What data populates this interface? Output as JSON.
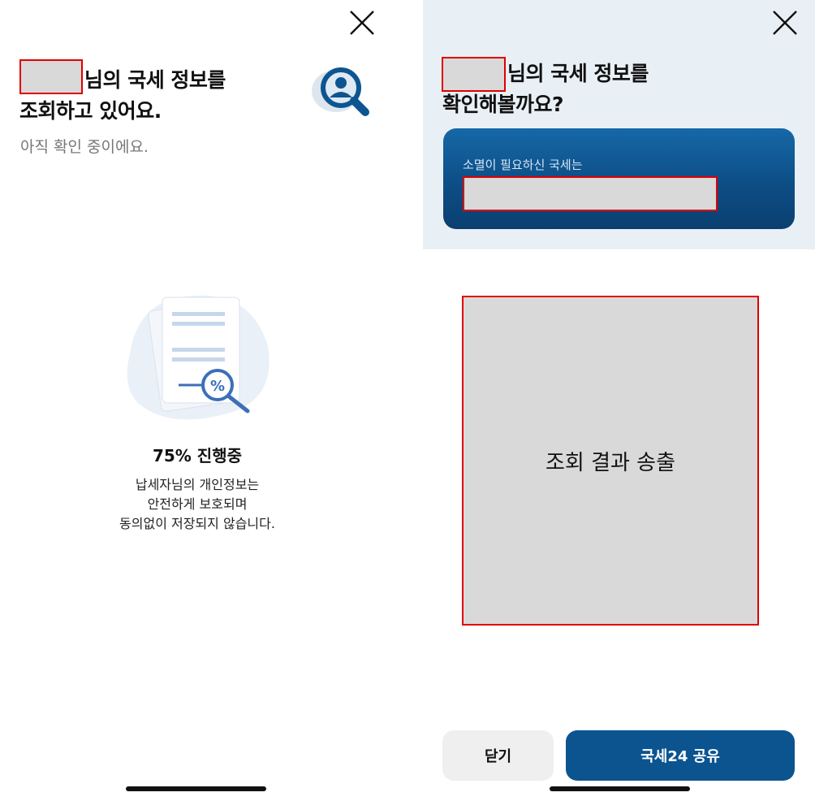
{
  "left": {
    "title_line1": "님의 국세 정보를",
    "title_line2": "조회하고 있어요.",
    "subtitle": "아직 확인 중이에요.",
    "progress": "75% 진행중",
    "progress_percent": 75,
    "info_line1": "납세자님의 개인정보는",
    "info_line2": "안전하게 보호되며",
    "info_line3": "동의없이 저장되지 않습니다.",
    "icons": {
      "close": "close-icon",
      "search": "user-search-icon",
      "document": "document-percent-illustration"
    }
  },
  "right": {
    "title_line1": "님의 국세 정보를",
    "title_line2": "확인해볼까요?",
    "card_label": "소멸이 필요하신 국세는",
    "result_placeholder": "조회 결과 송출",
    "close_button": "닫기",
    "share_button": "국세24 공유",
    "colors": {
      "primary": "#0b5490",
      "header_bg": "#e9f0f5",
      "redaction": "#d9d9d9",
      "redaction_border": "#e00000"
    }
  }
}
